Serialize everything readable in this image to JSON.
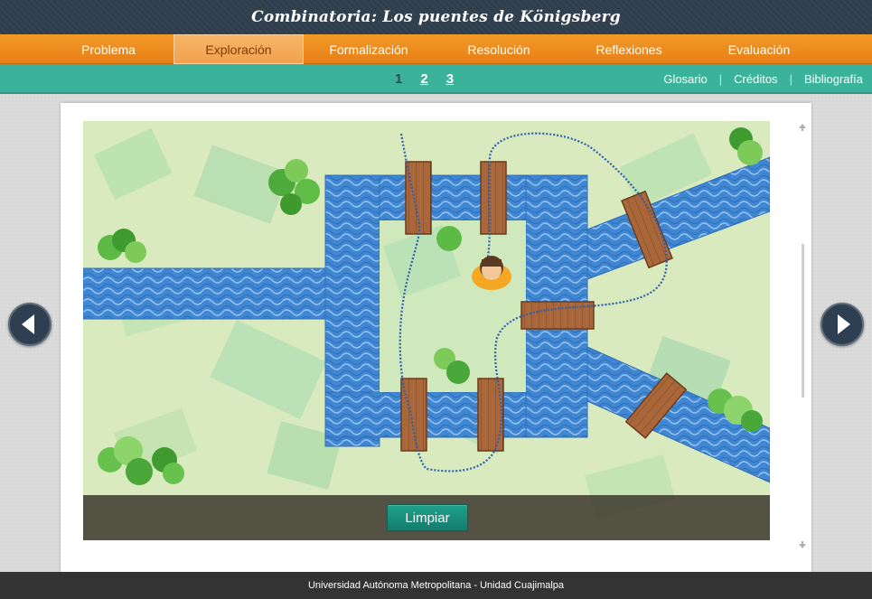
{
  "header": {
    "title": "Combinatoria: Los puentes de Königsberg"
  },
  "nav": {
    "items": [
      {
        "label": "Problema",
        "active": false
      },
      {
        "label": "Exploración",
        "active": true
      },
      {
        "label": "Formalización",
        "active": false
      },
      {
        "label": "Resolución",
        "active": false
      },
      {
        "label": "Reflexiones",
        "active": false
      },
      {
        "label": "Evaluación",
        "active": false
      }
    ]
  },
  "subnav": {
    "pages": [
      "1",
      "2",
      "3"
    ],
    "current_page": "1",
    "links": [
      "Glosario",
      "Créditos",
      "Bibliografía"
    ]
  },
  "activity": {
    "clear_label": "Limpiar",
    "icons": [
      "map-scene",
      "bridge",
      "character",
      "tree",
      "prev-arrow",
      "next-arrow"
    ]
  },
  "footer": {
    "text": "Universidad Autónoma Metropolitana - Unidad Cuajimalpa"
  },
  "colors": {
    "title_bar": "#2f3e4c",
    "nav_orange": "#f39a2a",
    "nav_active": "#f7b66a",
    "subnav_teal": "#3bb39b",
    "river_blue": "#3f86d3",
    "grass_green": "#bfe6b5",
    "button_teal": "#1fa18d",
    "footer": "#333333"
  }
}
